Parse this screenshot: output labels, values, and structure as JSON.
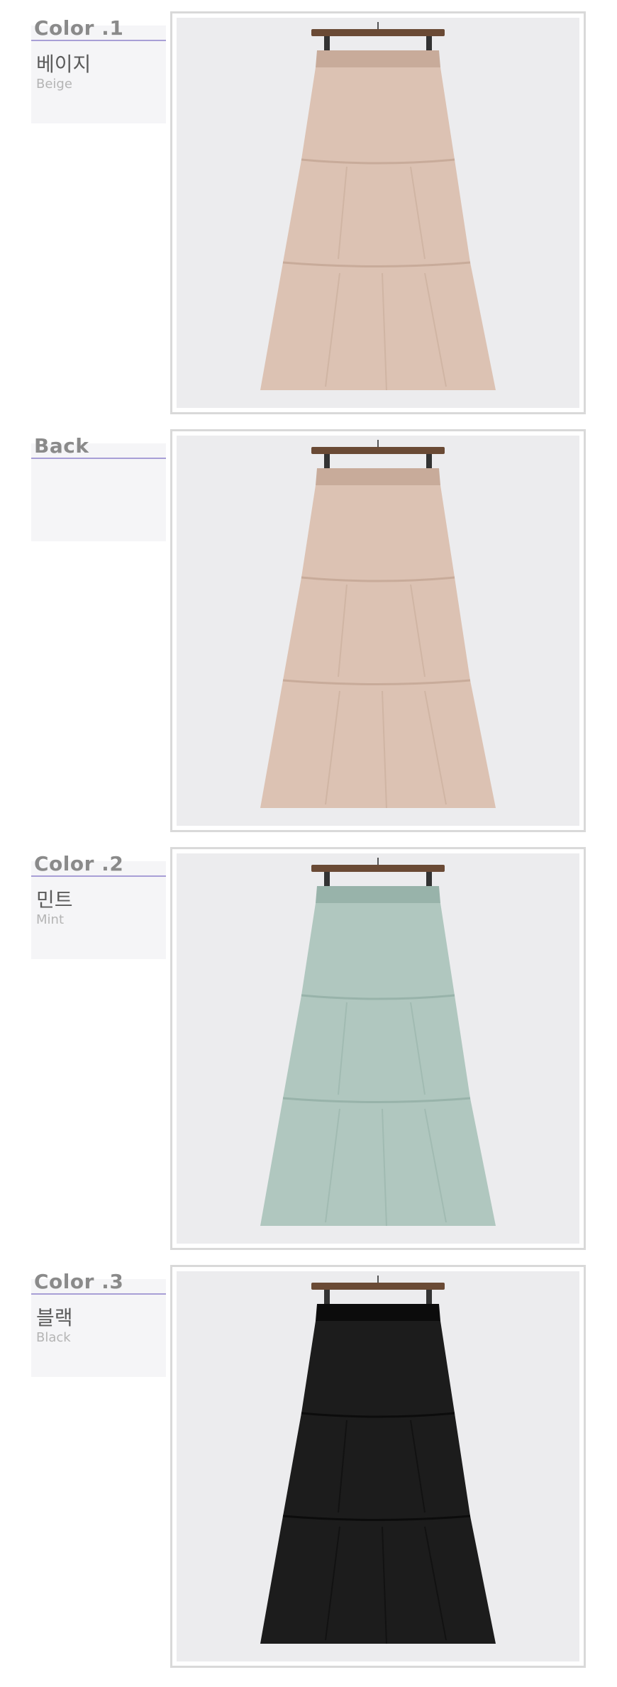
{
  "sections": [
    {
      "title": "Color .1",
      "name_ko": "베이지",
      "name_en": "Beige",
      "photo": {
        "subject": "skirt-photo",
        "color": "#dcc2b3",
        "shade": "#c8ab9a"
      }
    },
    {
      "title": "Back",
      "name_ko": "",
      "name_en": "",
      "photo": {
        "subject": "skirt-photo",
        "color": "#dcc2b3",
        "shade": "#c8ab9a"
      }
    },
    {
      "title": "Color .2",
      "name_ko": "민트",
      "name_en": "Mint",
      "photo": {
        "subject": "skirt-photo",
        "color": "#b0c7bf",
        "shade": "#98b3aa"
      }
    },
    {
      "title": "Color .3",
      "name_ko": "블랙",
      "name_en": "Black",
      "photo": {
        "subject": "skirt-photo",
        "color": "#1c1c1c",
        "shade": "#0c0c0c"
      }
    }
  ]
}
